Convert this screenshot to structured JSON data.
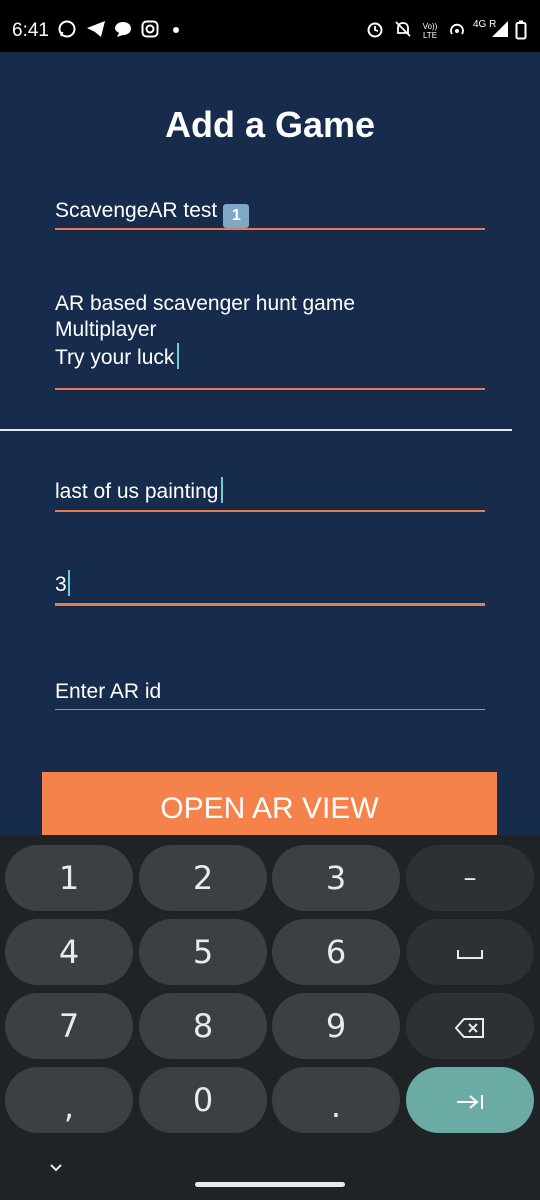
{
  "status_bar": {
    "time": "6:41",
    "volte_label": "Vo)) LTE",
    "network_label": "4G R"
  },
  "form": {
    "title": "Add a Game",
    "game_name_value": "ScavengeAR test",
    "game_name_badge": "1",
    "description_value": "AR based scavenger hunt game\nMultiplayer\nTry your luck",
    "clue_value": "last of us painting",
    "number_value": "3",
    "ar_id_placeholder": "Enter AR id",
    "open_ar_label": "OPEN AR VIEW"
  },
  "keyboard": {
    "keys": [
      "1",
      "2",
      "3",
      "–",
      "4",
      "5",
      "6",
      "",
      "7",
      "8",
      "9",
      "",
      "",
      "0",
      ".",
      ""
    ],
    "comma": ","
  },
  "colors": {
    "background": "#172b4d",
    "accent": "#f5824a",
    "underline": "#e97b4b",
    "cursor": "#6ecbd0",
    "enter_key": "#6aaba6"
  },
  "icons": [
    "whatsapp-icon",
    "telegram-icon",
    "chat-icon",
    "instagram-icon",
    "alarm-icon",
    "mute-icon",
    "hotspot-icon",
    "signal-icon",
    "battery-icon",
    "space-icon",
    "backspace-icon",
    "next-field-icon",
    "chevron-down-icon"
  ]
}
